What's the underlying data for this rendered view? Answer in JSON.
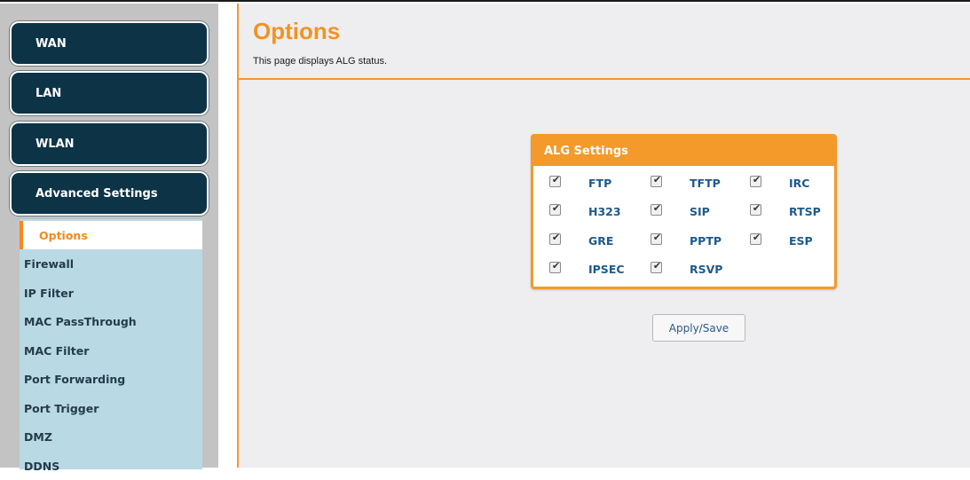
{
  "sidebar": {
    "sections": [
      {
        "label": "WAN"
      },
      {
        "label": "LAN"
      },
      {
        "label": "WLAN"
      },
      {
        "label": "Advanced Settings"
      }
    ],
    "items": [
      {
        "label": "Options",
        "active": true
      },
      {
        "label": "Firewall"
      },
      {
        "label": "IP Filter"
      },
      {
        "label": "MAC PassThrough"
      },
      {
        "label": "MAC Filter"
      },
      {
        "label": "Port Forwarding"
      },
      {
        "label": "Port Trigger"
      },
      {
        "label": "DMZ"
      },
      {
        "label": "DDNS"
      }
    ]
  },
  "header": {
    "title": "Options",
    "description": "This page displays ALG status."
  },
  "alg": {
    "title": "ALG Settings",
    "items": [
      {
        "label": "FTP",
        "checked": true
      },
      {
        "label": "TFTP",
        "checked": true
      },
      {
        "label": "IRC",
        "checked": true
      },
      {
        "label": "H323",
        "checked": true
      },
      {
        "label": "SIP",
        "checked": true
      },
      {
        "label": "RTSP",
        "checked": true
      },
      {
        "label": "GRE",
        "checked": true
      },
      {
        "label": "PPTP",
        "checked": true
      },
      {
        "label": "ESP",
        "checked": true
      },
      {
        "label": "IPSEC",
        "checked": true
      },
      {
        "label": "RSVP",
        "checked": true
      }
    ],
    "apply_label": "Apply/Save"
  },
  "colors": {
    "accent": "#f39a2a",
    "nav_dark": "#0d3347",
    "submenu_bg": "#b9d9e5",
    "link_blue": "#1e5a8a"
  }
}
